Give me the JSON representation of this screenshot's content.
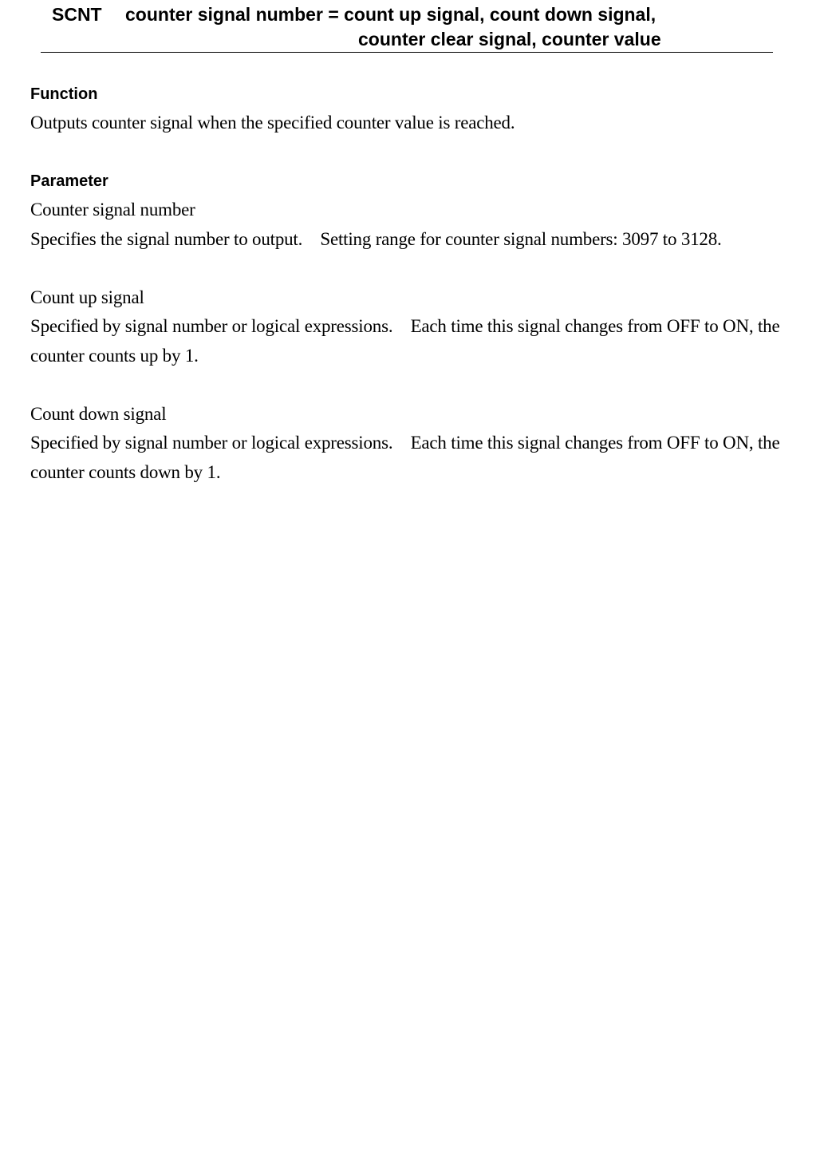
{
  "syntax": {
    "command": "SCNT",
    "line1": "counter signal number = count up signal, count down signal,",
    "line2": "counter clear signal, counter value"
  },
  "function": {
    "heading": "Function",
    "text": "Outputs counter signal when the specified counter value is reached."
  },
  "parameter": {
    "heading": "Parameter",
    "items": [
      {
        "name": "Counter signal number",
        "description": "Specifies the signal number to output.    Setting range for counter signal numbers: 3097 to 3128."
      },
      {
        "name": "Count up signal",
        "description": "Specified by signal number or logical expressions.    Each time this signal changes from OFF to ON, the counter counts up by 1."
      },
      {
        "name": "Count down signal",
        "description": "Specified by signal number or logical expressions.    Each time this signal changes from OFF to ON, the counter counts down by 1."
      }
    ]
  }
}
